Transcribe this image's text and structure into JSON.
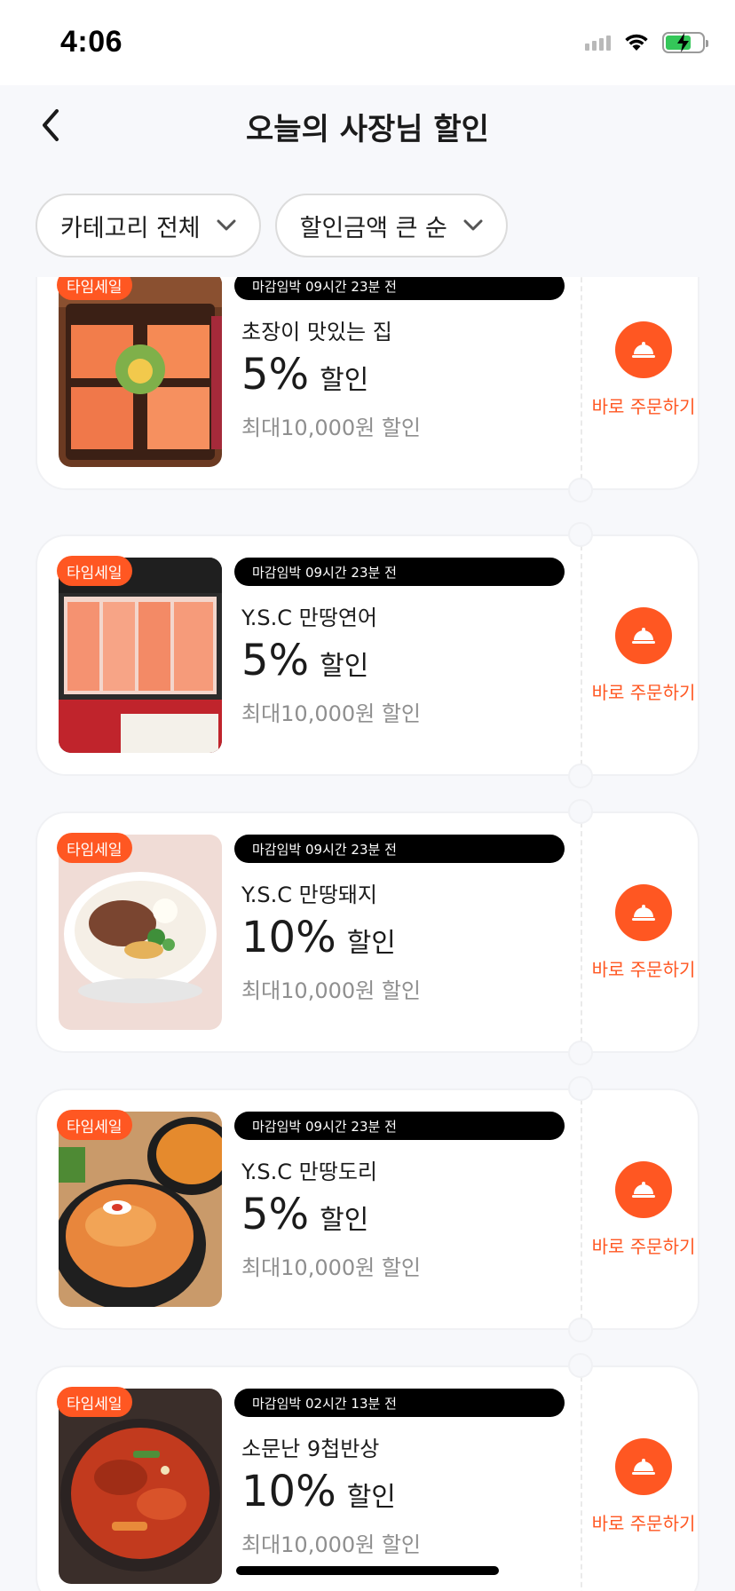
{
  "status_bar": {
    "time": "4:06"
  },
  "header": {
    "title": "오늘의 사장님 할인"
  },
  "filters": {
    "category_label": "카테고리 전체",
    "sort_label": "할인금액 큰 순"
  },
  "colors": {
    "accent": "#ff5722",
    "badge_bg": "#000000"
  },
  "deals": [
    {
      "badge": "타임세일",
      "deadline": "마감임박 09시간 23분 전",
      "store": "초장이 맛있는 집",
      "percent": "5%",
      "percent_suffix": "할인",
      "max_discount": "최대10,000원 할인",
      "order_label": "바로 주문하기"
    },
    {
      "badge": "타임세일",
      "deadline": "마감임박 09시간 23분 전",
      "store": "Y.S.C 만땅연어",
      "percent": "5%",
      "percent_suffix": "할인",
      "max_discount": "최대10,000원 할인",
      "order_label": "바로 주문하기"
    },
    {
      "badge": "타임세일",
      "deadline": "마감임박 09시간 23분 전",
      "store": "Y.S.C 만땅돼지",
      "percent": "10%",
      "percent_suffix": "할인",
      "max_discount": "최대10,000원 할인",
      "order_label": "바로 주문하기"
    },
    {
      "badge": "타임세일",
      "deadline": "마감임박 09시간 23분 전",
      "store": "Y.S.C 만땅도리",
      "percent": "5%",
      "percent_suffix": "할인",
      "max_discount": "최대10,000원 할인",
      "order_label": "바로 주문하기"
    },
    {
      "badge": "타임세일",
      "deadline": "마감임박 02시간 13분 전",
      "store": "소문난 9첩반상",
      "percent": "10%",
      "percent_suffix": "할인",
      "max_discount": "최대10,000원 할인",
      "order_label": "바로 주문하기"
    }
  ]
}
